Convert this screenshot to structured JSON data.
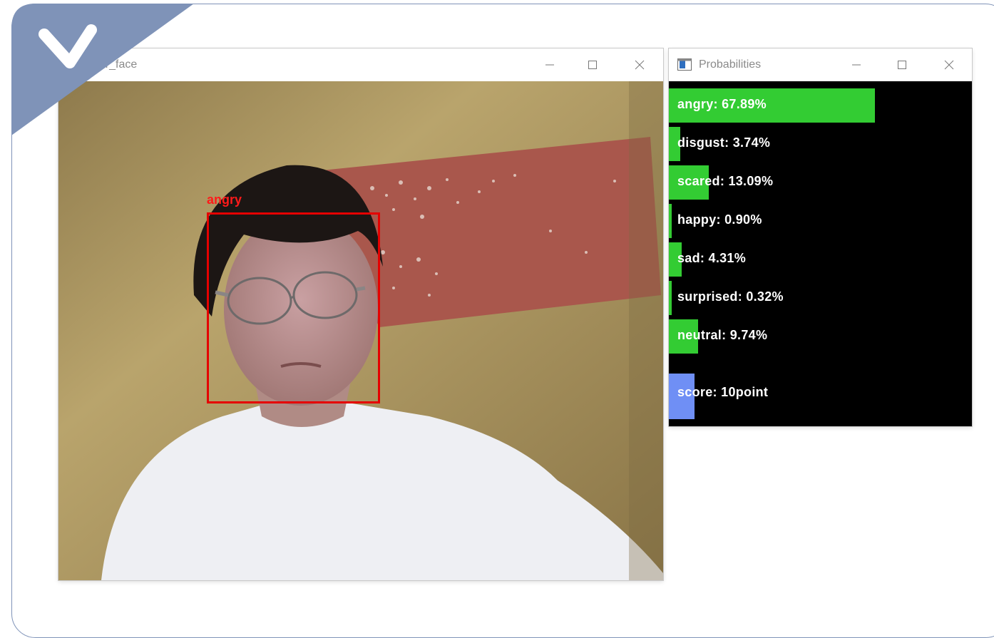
{
  "camera_window": {
    "title": "your_face",
    "face_label": "angry"
  },
  "probabilities_window": {
    "title": "Probabilities",
    "rows": [
      {
        "label": "angry: 67.89%",
        "value": 67.89
      },
      {
        "label": "disgust: 3.74%",
        "value": 3.74
      },
      {
        "label": "scared: 13.09%",
        "value": 13.09
      },
      {
        "label": "happy: 0.90%",
        "value": 0.9
      },
      {
        "label": "sad: 4.31%",
        "value": 4.31
      },
      {
        "label": "surprised: 0.32%",
        "value": 0.32
      },
      {
        "label": "neutral: 9.74%",
        "value": 9.74
      }
    ],
    "score_label": "score: 10point",
    "score_value": 10
  },
  "colors": {
    "bar": "#33cc33",
    "score_bar": "#6f8ff5",
    "face_box": "#e50000",
    "frame": "#7f93b8"
  }
}
